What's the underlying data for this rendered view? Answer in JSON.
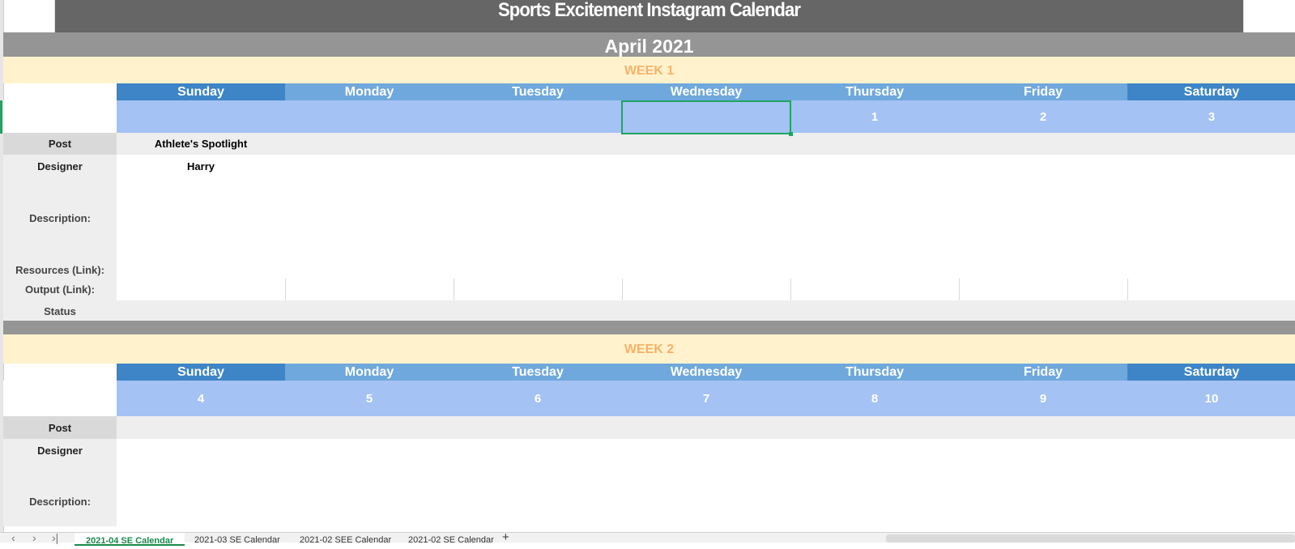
{
  "title": "Sports Excitement Instagram Calendar",
  "month": "April 2021",
  "row_labels": {
    "post": "Post",
    "designer": "Designer",
    "description": "Description:",
    "resources": "Resources (Link):",
    "output": "Output (Link):",
    "status": "Status"
  },
  "week1": {
    "title": "WEEK 1",
    "days": [
      "Sunday",
      "Monday",
      "Tuesday",
      "Wednesday",
      "Thursday",
      "Friday",
      "Saturday"
    ],
    "dates": [
      "",
      "",
      "",
      "",
      "1",
      "2",
      "3"
    ],
    "sunday_post": "Athlete's Spotlight",
    "sunday_designer": "Harry"
  },
  "week2": {
    "title": "WEEK 2",
    "days": [
      "Sunday",
      "Monday",
      "Tuesday",
      "Wednesday",
      "Thursday",
      "Friday",
      "Saturday"
    ],
    "dates": [
      "4",
      "5",
      "6",
      "7",
      "8",
      "9",
      "10"
    ]
  },
  "tabs": {
    "active": "2021-04 SE Calendar",
    "tab2": "2021-03 SE Calendar",
    "tab3": "2021-02 SEE Calendar",
    "tab4": "2021-02 SE Calendar",
    "add": "+"
  },
  "colors": {
    "header_dark": "#3d85c6",
    "header_light": "#6fa8dc",
    "date_row": "#a4c2f4",
    "week_band": "#fff2cc",
    "week_text": "#f6b26b",
    "selection": "#1fa463"
  }
}
